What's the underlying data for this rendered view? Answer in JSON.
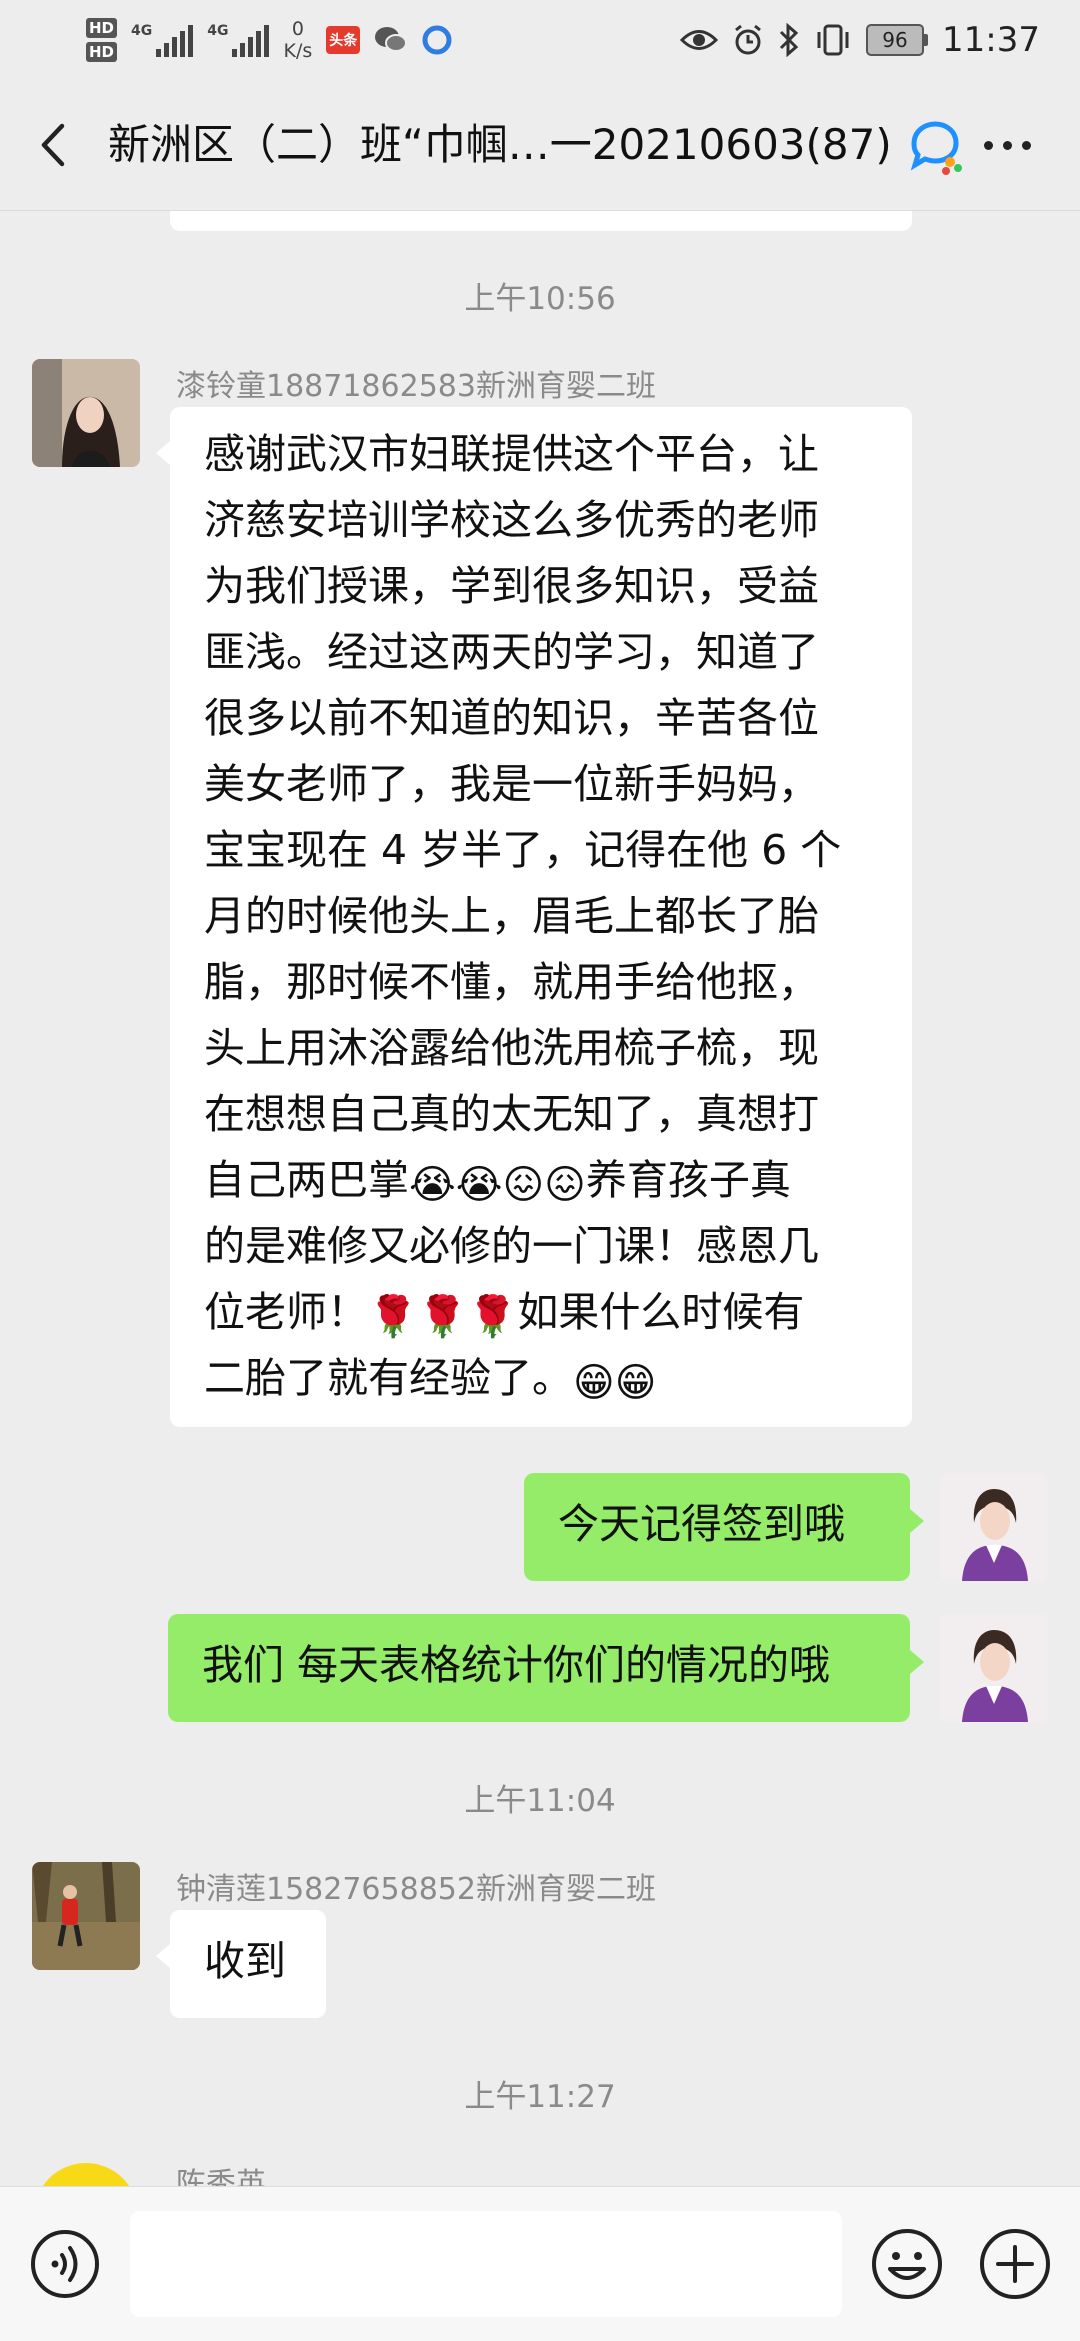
{
  "status_bar": {
    "hd1": "HD",
    "hd2": "HD",
    "net1": "4G",
    "net2": "4G",
    "speed_value": "0",
    "speed_unit": "K/s",
    "app_badge": "头条",
    "battery": "96",
    "time": "11:37"
  },
  "nav": {
    "title": "新洲区（二）班“巾帼…一20210603(87)"
  },
  "messages": [
    {
      "type": "time",
      "text": "上午10:56"
    },
    {
      "type": "incoming",
      "sender": "漆铃童18871862583新洲育婴二班",
      "lines": [
        "感谢武汉市妇联提供这个平台，让",
        "济慈安培训学校这么多优秀的老师",
        "为我们授课，学到很多知识，受益",
        "匪浅。经过这两天的学习，知道了",
        "很多以前不知道的知识，辛苦各位",
        "美女老师了，我是一位新手妈妈，",
        "宝宝现在 4 岁半了，记得在他 6 个",
        "月的时候他头上，眉毛上都长了胎",
        "脂，那时候不懂，就用手给他抠，",
        "头上用沐浴露给他洗用梳子梳，现",
        "在想想自己真的太无知了，真想打"
      ],
      "line_emoji_prefix": "自己两巴掌",
      "line_emoji": "😭😭😖😖",
      "line_emoji_suffix": "养育孩子真",
      "line_12": "的是难修又必修的一门课！感恩几",
      "line_13_prefix": "位老师！",
      "line_13_emoji": "🌹🌹🌹",
      "line_13_suffix": "如果什么时候有",
      "line_14_text": "二胎了就有经验了。",
      "line_14_emoji": "😁😁"
    },
    {
      "type": "outgoing",
      "text": "今天记得签到哦"
    },
    {
      "type": "outgoing",
      "text": "我们 每天表格统计你们的情况的哦"
    },
    {
      "type": "time",
      "text": "上午11:04"
    },
    {
      "type": "incoming",
      "sender": "钟清莲15827658852新洲育婴二班",
      "text": "收到"
    },
    {
      "type": "time",
      "text": "上午11:27"
    },
    {
      "type": "incoming_partial",
      "sender": "陈秀英"
    }
  ],
  "icons": {
    "back": "chevron-left-icon",
    "group": "chat-bubble-icon",
    "more": "more-dots-icon",
    "voice": "voice-icon",
    "emoji": "emoji-icon",
    "plus": "plus-icon"
  },
  "colors": {
    "background": "#ededed",
    "incoming_bubble": "#ffffff",
    "outgoing_bubble": "#95ec69",
    "timestamp": "#8a8a8a"
  }
}
